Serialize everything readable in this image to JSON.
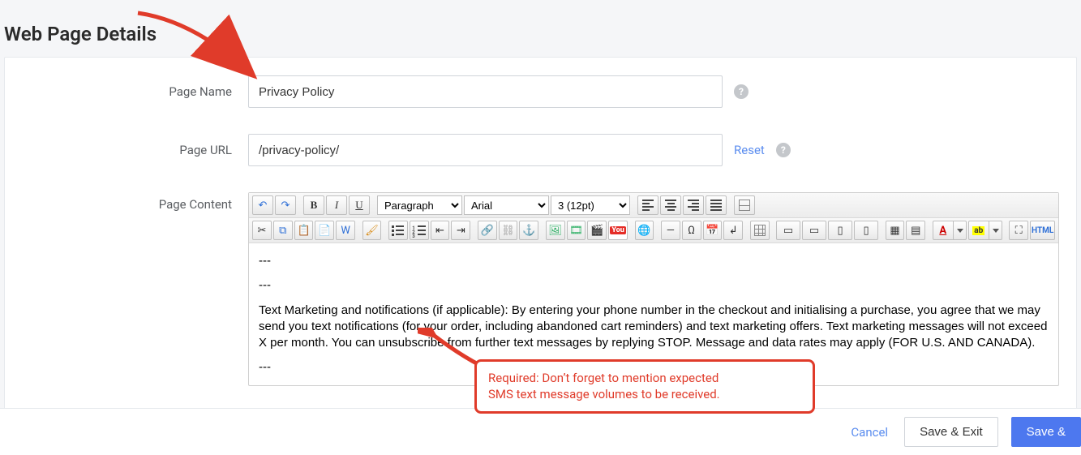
{
  "heading": "Web Page Details",
  "fields": {
    "page_name": {
      "label": "Page Name",
      "value": "Privacy Policy"
    },
    "page_url": {
      "label": "Page URL",
      "value": "/privacy-policy/",
      "reset": "Reset"
    },
    "page_content_label": "Page Content"
  },
  "editor": {
    "block_format": "Paragraph",
    "font_face": "Arial",
    "font_size": "3 (12pt)",
    "html_btn": "HTML",
    "youtube_label": "You",
    "content": {
      "dash1": "---",
      "dash2": "---",
      "para": "Text Marketing and notifications (if applicable): By entering your phone number in the checkout and initialising a purchase, you agree that we may send you text notifications (for your order, including abandoned cart reminders) and text marketing offers. Text marketing messages will not exceed X per month. You can unsubscribe from further text messages by replying STOP. Message and data rates may apply (FOR U.S. AND CANADA).",
      "dash3": "---"
    }
  },
  "callout": {
    "line1": "Required: Don’t forget to mention expected",
    "line2": "SMS text message volumes to be received."
  },
  "footer": {
    "cancel": "Cancel",
    "save_exit": "Save & Exit",
    "save": "Save &"
  }
}
